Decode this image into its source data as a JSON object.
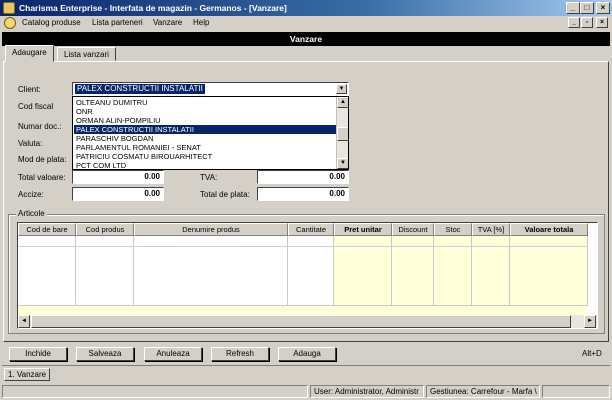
{
  "window": {
    "title": "Charisma Enterprise - Interfata de magazin - Germanos - [Vanzare]",
    "min_label": "_",
    "max_label": "□",
    "close_label": "×"
  },
  "mdi_controls": {
    "min_label": "_",
    "restore_label": "▫",
    "close_label": "×"
  },
  "menu": {
    "items": [
      "Catalog produse",
      "Lista parteneri",
      "Vanzare",
      "Help"
    ]
  },
  "form": {
    "header": "Vanzare",
    "tabs": [
      "Adaugare",
      "Lista vanzari"
    ],
    "labels": {
      "client": "Client:",
      "cod_fiscal": "Cod fiscal",
      "numar_doc": "Numar doc.:",
      "valuta": "Valuta:",
      "mod_plata": "Mod de plata:",
      "total_valoare": "Total valoare:",
      "accize": "Accize:",
      "tva": "TVA:",
      "total_plata": "Total de plata:"
    },
    "client_value": "PALEX CONSTRUCTII INSTALATII",
    "values": {
      "total_valoare": "0.00",
      "accize": "0.00",
      "tva": "0.00",
      "total_plata": "0.00"
    },
    "client_dropdown": [
      "OLTEANU DUMITRU",
      "ONR",
      "ORMAN ALIN-POMPILIU",
      "PALEX CONSTRUCTII INSTALATII",
      "PARASCHIV BOGDAN",
      "PARLAMENTUL ROMANIEI - SENAT",
      "PATRICIU COSMATU BIROUARHITECT",
      "PCT COM LTD"
    ],
    "scroll_up": "▲",
    "scroll_down": "▼",
    "combo_arrow": "▼"
  },
  "articole": {
    "group_label": "Articole",
    "columns": [
      "Cod de bare",
      "Cod produs",
      "Denumire produs",
      "Cantitate",
      "Pret unitar",
      "Discount",
      "Stoc",
      "TVA [%]",
      "Valoare totala"
    ],
    "scroll_left": "◄",
    "scroll_right": "►"
  },
  "buttons": [
    "Inchide",
    "Salveaza",
    "Anuleaza",
    "Refresh",
    "Adauga"
  ],
  "shortcut": "Alt+D",
  "task_tab": "1. Vanzare",
  "status": {
    "user": "User: Administrator, Administr",
    "gestiune": "Gestiunea: Carrefour - Marfa \\"
  }
}
